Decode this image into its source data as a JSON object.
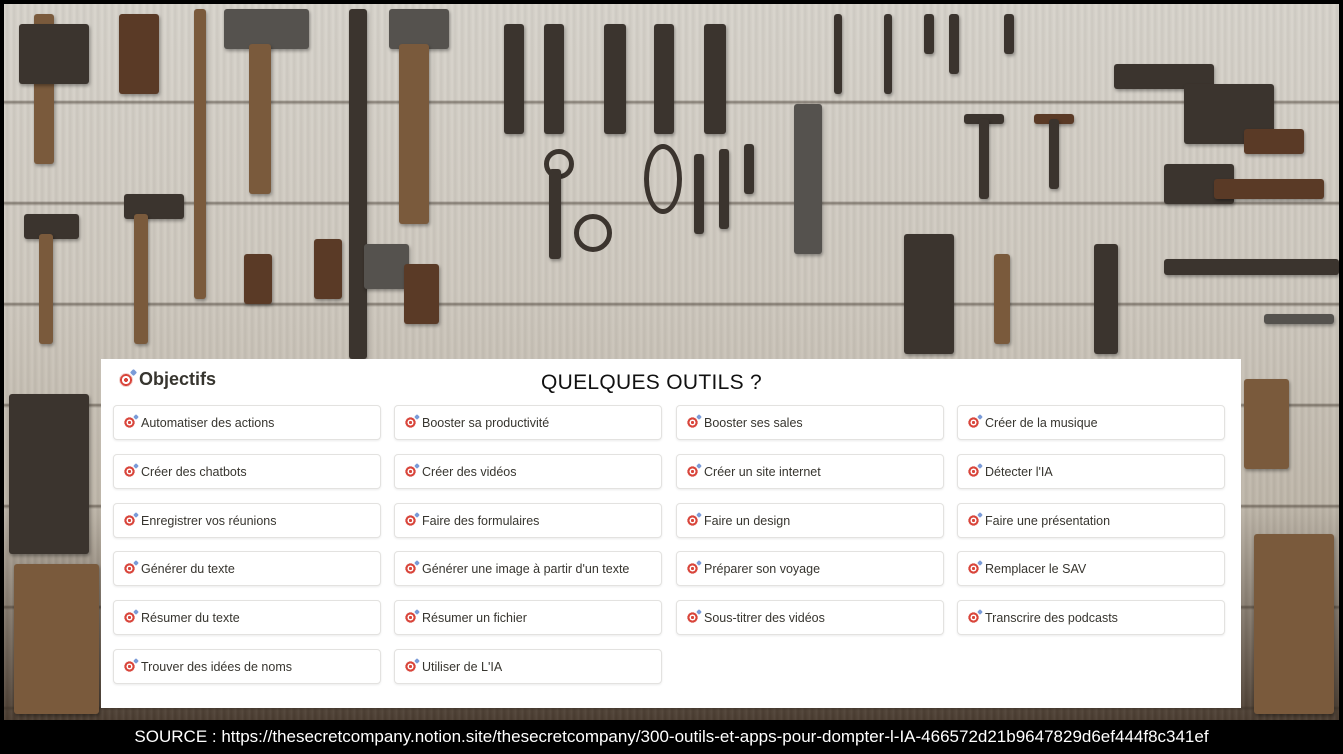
{
  "header": {
    "icon": "target-icon",
    "title": "Objectifs"
  },
  "main_title": "QUELQUES OUTILS ?",
  "cards": [
    [
      "Automatiser des actions",
      "Booster sa productivité",
      "Booster ses sales",
      "Créer de la musique"
    ],
    [
      "Créer des chatbots",
      "Créer des vidéos",
      "Créer un site internet",
      "Détecter l'IA"
    ],
    [
      "Enregistrer vos réunions",
      "Faire des formulaires",
      "Faire un design",
      "Faire une présentation"
    ],
    [
      "Générer du texte",
      "Générer une image à partir d'un texte",
      "Préparer son voyage",
      "Remplacer le SAV"
    ],
    [
      "Résumer du texte",
      "Résumer un fichier",
      "Sous-titrer des vidéos",
      "Transcrire des podcasts"
    ],
    [
      "Trouver des idées de noms",
      "Utiliser de L'IA"
    ]
  ],
  "source": "SOURCE : https://thesecretcompany.notion.site/thesecretcompany/300-outils-et-apps-pour-dompter-l-IA-466572d21b9647829d6ef444f8c341ef"
}
